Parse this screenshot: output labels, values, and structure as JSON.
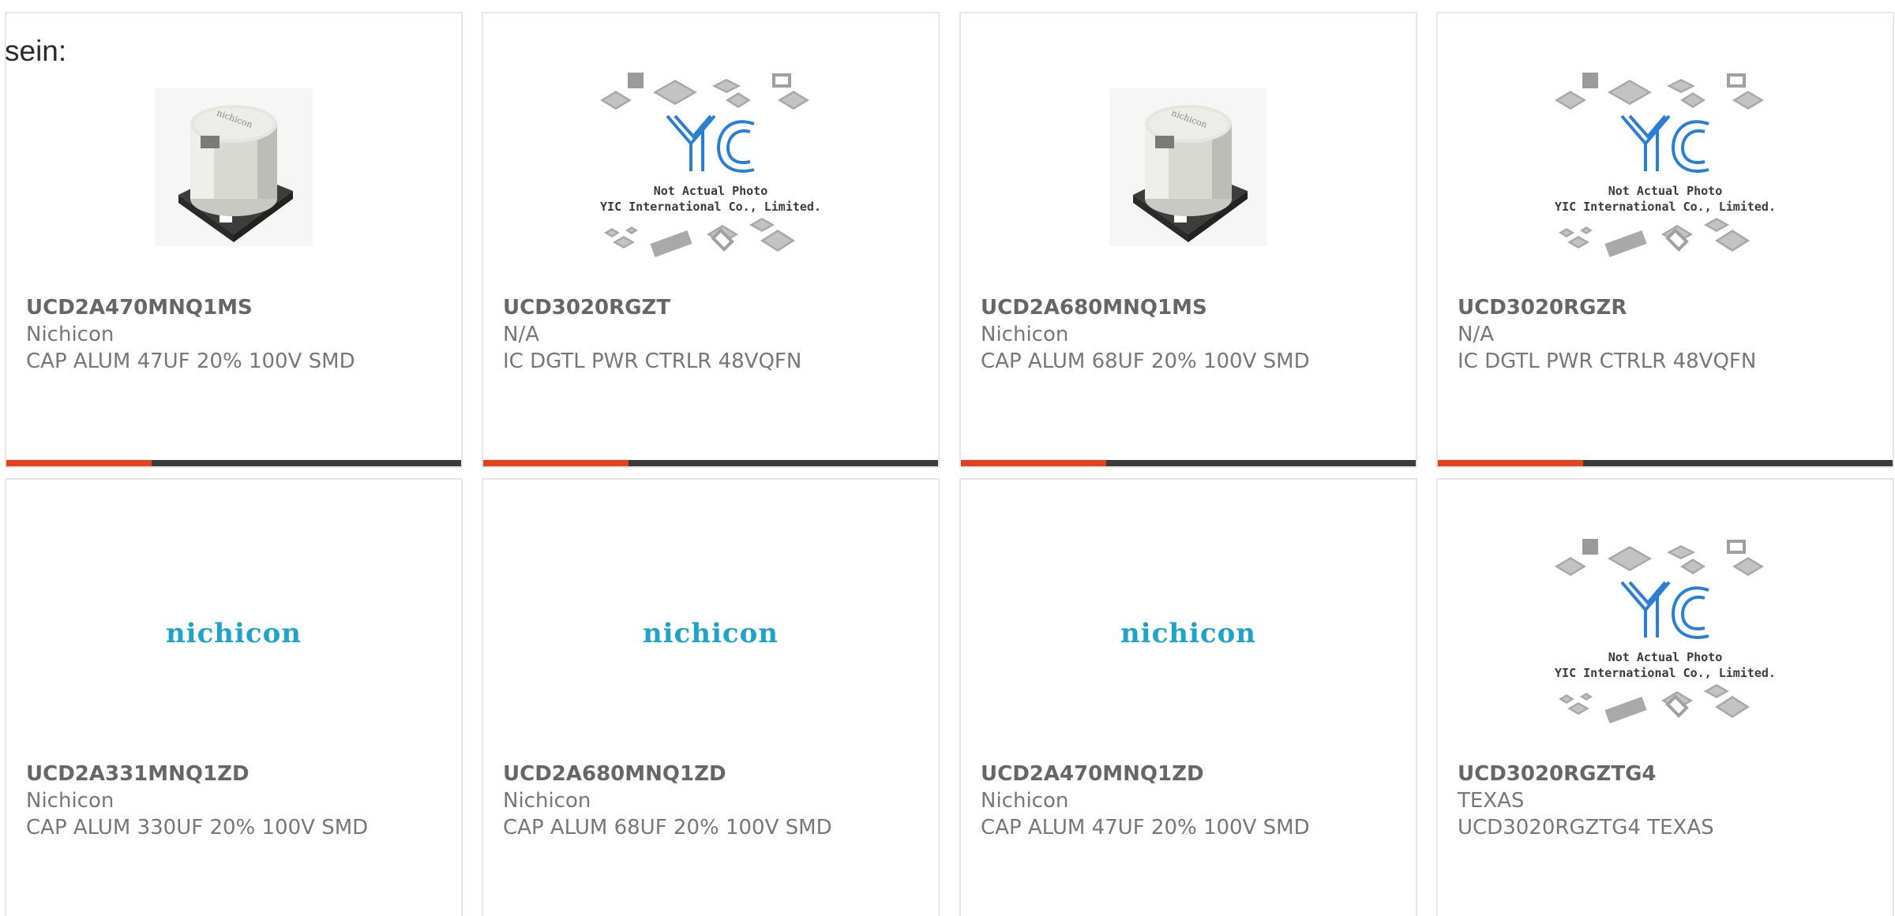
{
  "intro": "sein:",
  "colors": {
    "accent": "#e8401c",
    "bar": "#3b3b3b",
    "nichicon_blue": "#1fa3c8",
    "yic_blue": "#2a7fd4"
  },
  "products": [
    {
      "part": "UCD2A470MNQ1MS",
      "maker": "Nichicon",
      "desc": "CAP ALUM 47UF 20% 100V SMD",
      "image": "capacitor-photo"
    },
    {
      "part": "UCD3020RGZT",
      "maker": "N/A",
      "desc": "IC DGTL PWR CTRLR 48VQFN",
      "image": "yic-placeholder"
    },
    {
      "part": "UCD2A680MNQ1MS",
      "maker": "Nichicon",
      "desc": "CAP ALUM 68UF 20% 100V SMD",
      "image": "capacitor-photo"
    },
    {
      "part": "UCD3020RGZR",
      "maker": "N/A",
      "desc": "IC DGTL PWR CTRLR 48VQFN",
      "image": "yic-placeholder"
    },
    {
      "part": "UCD2A331MNQ1ZD",
      "maker": "Nichicon",
      "desc": "CAP ALUM 330UF 20% 100V SMD",
      "image": "nichicon-logo"
    },
    {
      "part": "UCD2A680MNQ1ZD",
      "maker": "Nichicon",
      "desc": "CAP ALUM 68UF 20% 100V SMD",
      "image": "nichicon-logo"
    },
    {
      "part": "UCD2A470MNQ1ZD",
      "maker": "Nichicon",
      "desc": "CAP ALUM 47UF 20% 100V SMD",
      "image": "nichicon-logo"
    },
    {
      "part": "UCD3020RGZTG4",
      "maker": "TEXAS",
      "desc": "UCD3020RGZTG4 TEXAS",
      "image": "yic-placeholder"
    }
  ],
  "yic": {
    "logo": "YIC",
    "line1": "Not Actual Photo",
    "line2": "YIC International Co., Limited."
  },
  "nichicon_logo_text": "nichicon",
  "capacitor_label": "nichicon"
}
